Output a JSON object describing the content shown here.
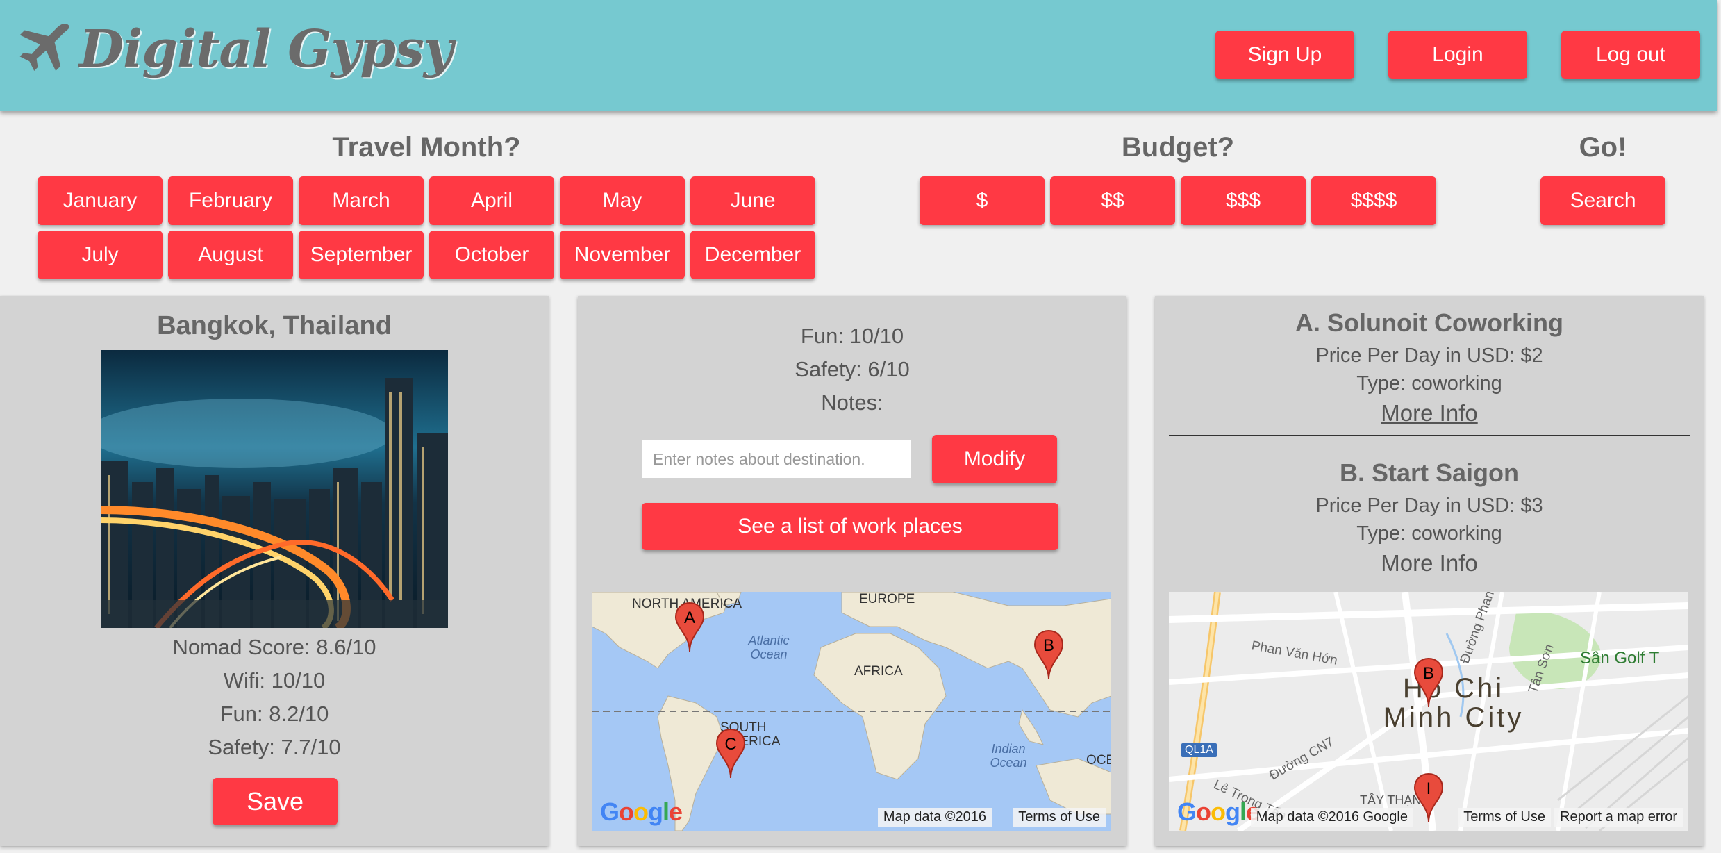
{
  "header": {
    "logo_text": "Digital Gypsy",
    "signup_label": "Sign Up",
    "login_label": "Login",
    "logout_label": "Log out"
  },
  "filters": {
    "month_title": "Travel Month?",
    "months": [
      "January",
      "February",
      "March",
      "April",
      "May",
      "June",
      "July",
      "August",
      "September",
      "October",
      "November",
      "December"
    ],
    "budget_title": "Budget?",
    "budgets": [
      "$",
      "$$",
      "$$$",
      "$$$$"
    ],
    "go_title": "Go!",
    "search_label": "Search"
  },
  "destination": {
    "title": "Bangkok, Thailand",
    "nomad_score": "Nomad Score: 8.6/10",
    "wifi": "Wifi: 10/10",
    "fun": "Fun: 8.2/10",
    "safety": "Safety: 7.7/10",
    "save_label": "Save"
  },
  "details": {
    "fun": "Fun: 10/10",
    "safety": "Safety: 6/10",
    "notes_label": "Notes:",
    "notes_placeholder": "Enter notes about destination.",
    "modify_label": "Modify",
    "worklist_label": "See a list of work places",
    "map": {
      "labels": [
        "NORTH AMERICA",
        "EUROPE",
        "AFRICA",
        "SOUTH AMERICA",
        "OCE"
      ],
      "oceans": [
        "Atlantic Ocean",
        "Indian Ocean"
      ],
      "markers": [
        "A",
        "B",
        "C"
      ],
      "footer_data": "Map data ©2016",
      "footer_terms": "Terms of Use"
    }
  },
  "workplaces": {
    "items": [
      {
        "title": "A. Solunoit Coworking",
        "price": "Price Per Day in USD: $2",
        "type": "Type: coworking",
        "more": "More Info"
      },
      {
        "title": "B. Start Saigon",
        "price": "Price Per Day in USD: $3",
        "type": "Type: coworking",
        "more": "More Info"
      }
    ],
    "map": {
      "city": "Ho Chi Minh City",
      "streets": [
        "Phan Văn Hớn",
        "Đường Phan",
        "Tân Sơn",
        "Đường CN7",
        "Lê Trọng Tấn",
        "TÂY THẠNH",
        "Sân Golf T",
        "QL1A"
      ],
      "markers": [
        "B",
        "I"
      ],
      "footer_data": "Map data ©2016 Google",
      "footer_terms": "Terms of Use",
      "footer_report": "Report a map error"
    }
  },
  "colors": {
    "header_bg": "#76c9d0",
    "accent": "#ff3944",
    "panel_bg": "#d3d3d3",
    "page_bg": "#f0f0f0"
  }
}
